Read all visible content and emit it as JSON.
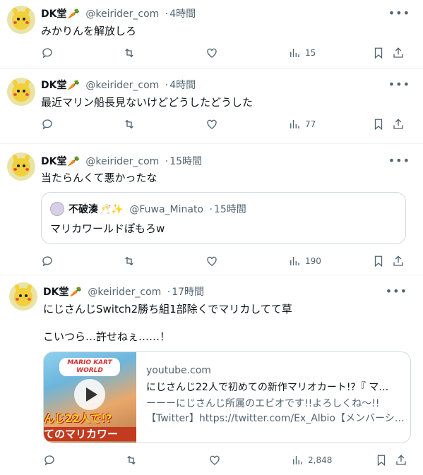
{
  "tweets": [
    {
      "name": "DK堂",
      "handle": "@keirider_com",
      "time": "4時間",
      "text": "みかりんを解放しろ",
      "views": "15"
    },
    {
      "name": "DK堂",
      "handle": "@keirider_com",
      "time": "4時間",
      "text": "最近マリン船長見ないけどどうしたどうした",
      "views": "77"
    },
    {
      "name": "DK堂",
      "handle": "@keirider_com",
      "time": "15時間",
      "text": "当たらんくて悪かったな",
      "views": "190",
      "quote": {
        "name": "不破湊",
        "handle": "@Fuwa_Minato",
        "time": "15時間",
        "text": "マリカワールドぽもろw"
      }
    },
    {
      "name": "DK堂",
      "handle": "@keirider_com",
      "time": "17時間",
      "text_line1": "にじさんじSwitch2勝ち組1部除くでマリカしてて草",
      "text_line2": "こいつら…許せねぇ……！",
      "views": "2,848",
      "card": {
        "domain": "youtube.com",
        "title": "にじさんじ22人で初めての新作マリオカート!?『 マ…",
        "desc_line1": "ーーーにじさんじ所属のエビオです!!よろしくね〜!!",
        "desc_line2": "【Twitter】https://twitter.com/Ex_Albio【メンバーシ…",
        "thumb_logo": "MARIO KART WORLD",
        "thumb_band1": "んじ22人で!?",
        "thumb_band2": "てのマリカワー"
      }
    }
  ],
  "icons": {
    "reply": "reply-icon",
    "retweet": "retweet-icon",
    "like": "heart-icon",
    "views": "views-chart-icon",
    "bookmark": "bookmark-icon",
    "share": "share-icon",
    "more": "more-dots-icon"
  },
  "colors": {
    "text": "#0f1419",
    "muted": "#536471",
    "border": "#cfd9de",
    "divider": "#eff3f4"
  }
}
